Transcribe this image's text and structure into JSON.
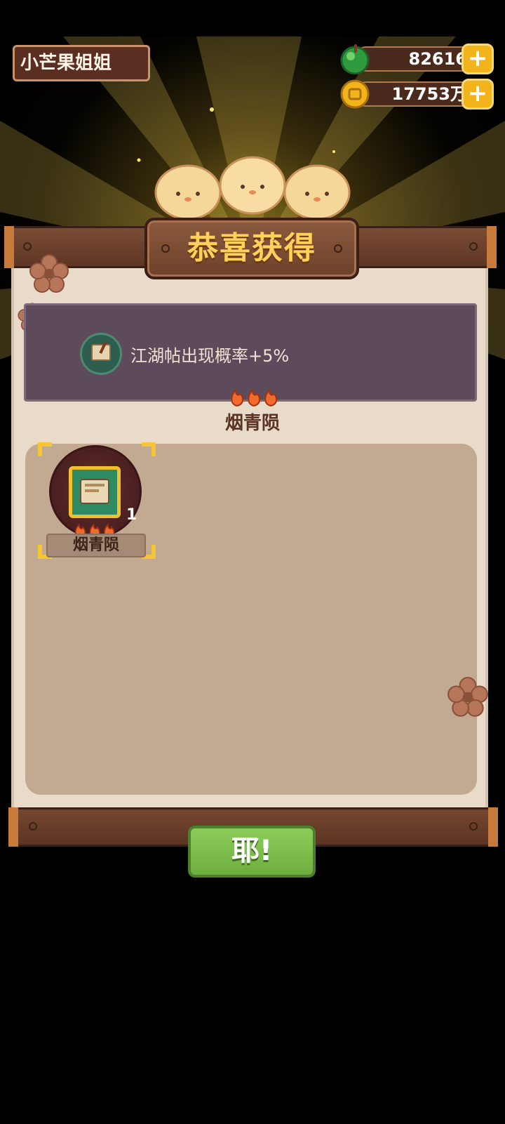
{
  "player": {
    "name": "小芒果姐姐"
  },
  "currencies": [
    {
      "icon": "green-apple-icon",
      "value": "82616",
      "color": "#3db04a"
    },
    {
      "icon": "gold-coin-icon",
      "value": "17753万",
      "color": "#f2b31b"
    }
  ],
  "reward_popup": {
    "title": "恭喜获得",
    "buff": {
      "icon": "scroll-map-icon",
      "text": "江湖帖出现概率+5%"
    },
    "source": {
      "name": "烟青陨",
      "level": 3
    },
    "items": [
      {
        "name": "烟青陨",
        "count": "1",
        "level": 3,
        "icon": "scroll-card-icon"
      }
    ],
    "confirm_label": "耶!"
  },
  "colors": {
    "accent": "#ffd15a",
    "wood": "#6d412b",
    "paper": "#e9dbca",
    "button": "#7bbd48"
  }
}
